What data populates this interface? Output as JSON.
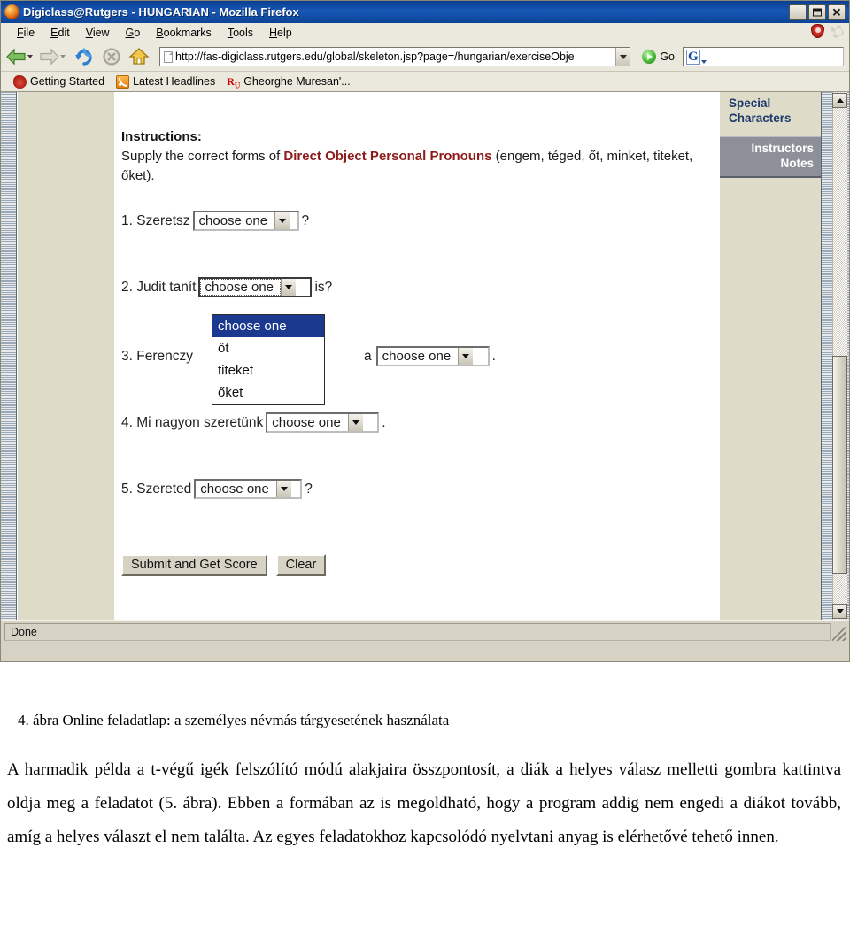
{
  "window": {
    "title": "Digiclass@Rutgers - HUNGARIAN - Mozilla Firefox",
    "minimize_label": "_",
    "maximize_label": "",
    "close_label": "✕"
  },
  "menu": {
    "items": [
      {
        "label": "File",
        "accel": "F",
        "rest": "ile"
      },
      {
        "label": "Edit",
        "accel": "E",
        "rest": "dit"
      },
      {
        "label": "View",
        "accel": "V",
        "rest": "iew"
      },
      {
        "label": "Go",
        "accel": "G",
        "rest": "o"
      },
      {
        "label": "Bookmarks",
        "accel": "B",
        "rest": "ookmarks"
      },
      {
        "label": "Tools",
        "accel": "T",
        "rest": "ools"
      },
      {
        "label": "Help",
        "accel": "H",
        "rest": "elp"
      }
    ]
  },
  "toolbar": {
    "url": "http://fas-digiclass.rutgers.edu/global/skeleton.jsp?page=/hungarian/exerciseObje",
    "go_label": "Go",
    "search_engine": "G"
  },
  "bookmarks": [
    {
      "label": "Getting Started",
      "icon": "paw-icon"
    },
    {
      "label": "Latest Headlines",
      "icon": "rss-icon"
    },
    {
      "label": "Gheorghe Muresan'...",
      "icon": "rutgers-icon"
    }
  ],
  "exercise": {
    "instructions_heading": "Instructions:",
    "instructions_pre": "Supply the correct forms of ",
    "instructions_em": "Direct Object Personal Pronouns",
    "instructions_post": " (engem, téged, őt, minket, titeket, őket).",
    "questions": [
      {
        "number": "1.",
        "pre": "1. Szeretsz",
        "post": "?",
        "select_value": "choose one"
      },
      {
        "number": "2.",
        "pre": "2. Judit tanít",
        "post": "is?",
        "select_value": "choose one"
      },
      {
        "number": "3.",
        "pre": "3. Ferenczy",
        "post": "a",
        "post2": ".",
        "select_value": "choose one"
      },
      {
        "number": "4.",
        "pre": "4. Mi nagyon szeretünk",
        "post": ".",
        "select_value": "choose one"
      },
      {
        "number": "5.",
        "pre": "5. Szereted",
        "post": "?",
        "select_value": "choose one"
      }
    ],
    "dropdown_options": [
      "choose one",
      "őt",
      "titeket",
      "őket"
    ],
    "dropdown_selected": "choose one",
    "submit_label": "Submit and Get Score",
    "clear_label": "Clear"
  },
  "sidebar": {
    "special_characters": "Special\nCharacters",
    "special_characters_line1": "Special",
    "special_characters_line2": "Characters",
    "instructors_notes_line1": "Instructors",
    "instructors_notes_line2": "Notes"
  },
  "status": {
    "text": "Done"
  },
  "document": {
    "figure_caption": "4. ábra Online feladatlap: a személyes névmás tárgyesetének használata",
    "paragraph": "A harmadik példa a t-végű igék felszólító módú alakjaira összpontosít, a diák a helyes válasz melletti gombra kattintva oldja meg a feladatot (5. ábra). Ebben a formában az is megoldható, hogy a program addig nem engedi a diákot tovább, amíg a helyes választ el nem találta. Az egyes feladatokhoz kapcsolódó nyelvtani anyag is elérhetővé tehető innen."
  },
  "colors": {
    "titlebar": "#1757b5",
    "chrome": "#ebe8dd",
    "sidebar_bg": "#dedbc8",
    "link_blue": "#1b3a6b",
    "accent_red": "#8f1a1a",
    "select_highlight": "#1b3a8f"
  }
}
